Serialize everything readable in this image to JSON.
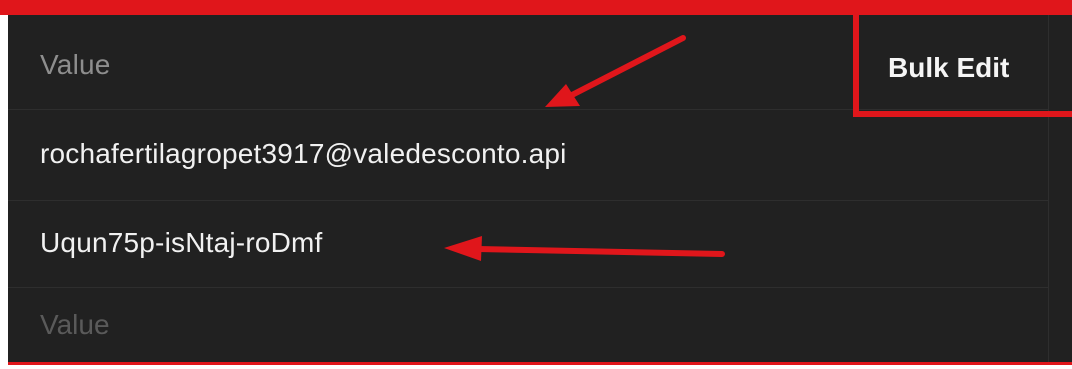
{
  "table": {
    "header_label": "Value",
    "bulk_edit_label": "Bulk Edit",
    "rows": [
      {
        "value": "rochafertilagropet3917@valedesconto.api"
      },
      {
        "value": "Uqun75p-isNtaj-roDmf"
      }
    ],
    "new_row_placeholder": "Value"
  },
  "annotations": {
    "accent_color": "#e0161b",
    "panel_color": "#212121"
  }
}
